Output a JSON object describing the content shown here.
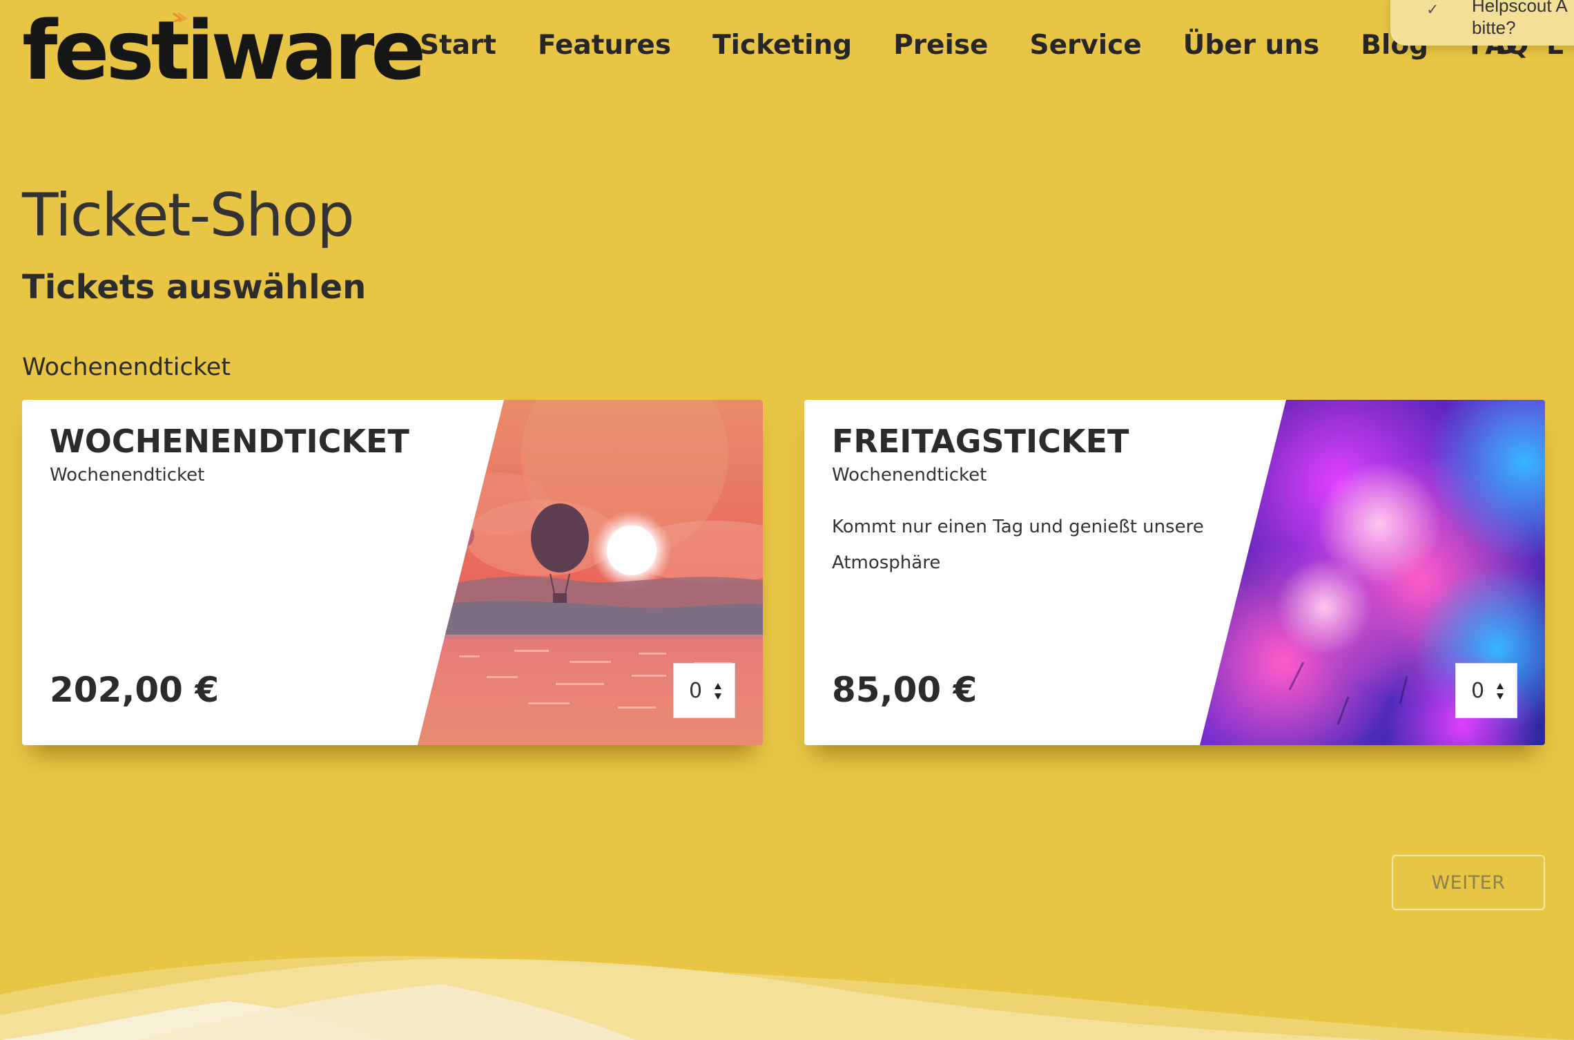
{
  "header": {
    "logo_text": "festiware",
    "nav": [
      {
        "label": "Start"
      },
      {
        "label": "Features"
      },
      {
        "label": "Ticketing"
      },
      {
        "label": "Preise"
      },
      {
        "label": "Service"
      },
      {
        "label": "Über uns"
      },
      {
        "label": "Blog"
      },
      {
        "label": "FAQ"
      }
    ],
    "language": "D E"
  },
  "helpscout": {
    "line1": "Helpscout A",
    "line2": "bitte?"
  },
  "main": {
    "title": "Ticket-Shop",
    "subtitle": "Tickets auswählen",
    "group_label": "Wochenendticket",
    "tickets": [
      {
        "name": "WOCHENENDTICKET",
        "category": "Wochenendticket",
        "description": "",
        "price": "202,00 €",
        "quantity": "0",
        "image": "hot-air-balloon-sunset"
      },
      {
        "name": "FREITAGSTICKET",
        "category": "Wochenendticket",
        "description": "Kommt nur einen Tag und genießt unsere Atmosphäre",
        "price": "85,00 €",
        "quantity": "0",
        "image": "colorful-powder-explosion"
      }
    ],
    "continue_label": "WEITER"
  },
  "colors": {
    "background": "#e8c544",
    "card": "#ffffff",
    "text": "#2b2b2b",
    "logo_accent": "#f08a2a"
  }
}
